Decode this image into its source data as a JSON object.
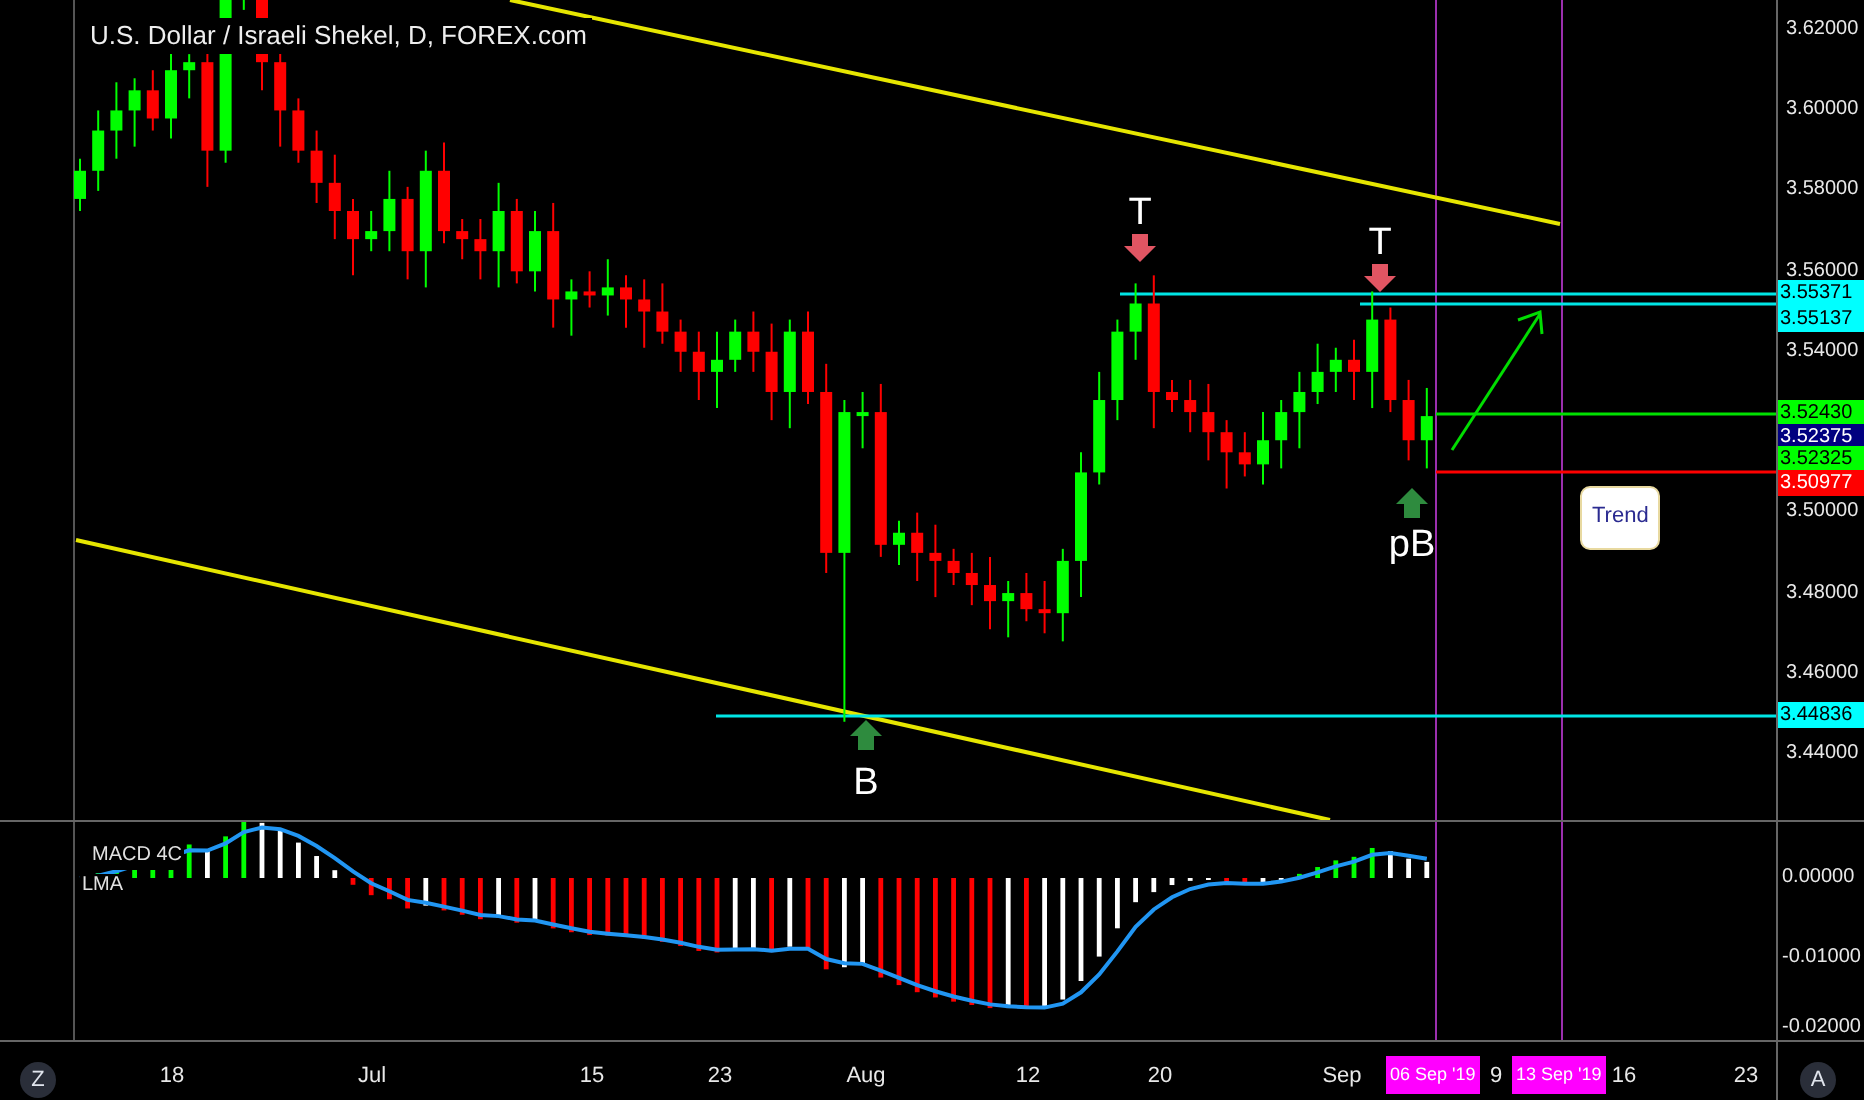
{
  "chart_title": "U.S. Dollar / Israeli Shekel, D, FOREX.com",
  "price_axis": {
    "ticks": [
      "3.62000",
      "3.60000",
      "3.58000",
      "3.56000",
      "3.54000",
      "3.50000",
      "3.48000",
      "3.46000",
      "3.44000"
    ]
  },
  "price_labels": [
    {
      "text": "3.55371",
      "color": "#00ffff"
    },
    {
      "text": "3.55137",
      "color": "#00ffff"
    },
    {
      "text": "3.52430",
      "color": "#00ff00"
    },
    {
      "text": "3.52375",
      "color": "#000080"
    },
    {
      "text": "3.52325",
      "color": "#00ff00"
    },
    {
      "text": "3.50977",
      "color": "#ff0000"
    },
    {
      "text": "3.44836",
      "color": "#00ffff"
    }
  ],
  "annotations": [
    {
      "text": "T",
      "kind": "top"
    },
    {
      "text": "T",
      "kind": "top"
    },
    {
      "text": "B",
      "kind": "bottom"
    },
    {
      "text": "pB",
      "kind": "bottom"
    }
  ],
  "callout": {
    "text": "Trend"
  },
  "indicator": {
    "name": "MACD 4C",
    "label": "LMA",
    "ticks": [
      "0.00000",
      "-0.01000",
      "-0.02000"
    ]
  },
  "time_axis": {
    "labels": [
      "18",
      "Jul",
      "15",
      "23",
      "Aug",
      "12",
      "20",
      "Sep",
      "9",
      "16",
      "23"
    ],
    "markers": [
      {
        "text": "06 Sep '19"
      },
      {
        "text": "13 Sep '19"
      }
    ]
  },
  "buttons": [
    "Z",
    "A"
  ]
}
